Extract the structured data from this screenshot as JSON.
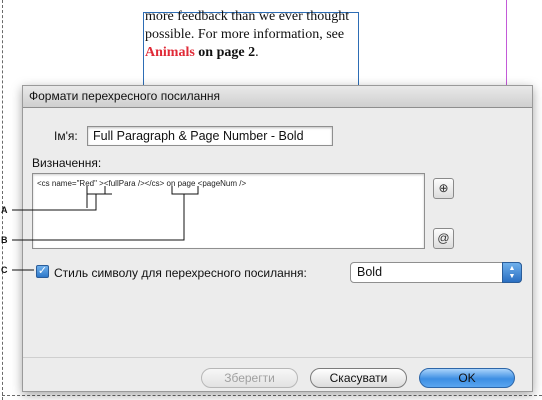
{
  "document": {
    "line1": "more feedback than we ever thought",
    "line2": "possible. For more information, see",
    "link_red": "Animals",
    "link_bold": " on page 2",
    "period": "."
  },
  "dialog": {
    "title": "Формати перехресного посилання",
    "name_label": "Ім'я:",
    "name_value": "Full Paragraph & Page Number - Bold",
    "definition_label": "Визначення:",
    "definition_code": "<cs name=\"Red\" ><fullPara /></cs> on page <pageNum />",
    "checkbox_label": "Стиль символу для перехресного посилання:",
    "checkbox_checked": true,
    "style_value": "Bold",
    "buttons": {
      "save": "Зберегти",
      "cancel": "Скасувати",
      "ok": "OK"
    }
  },
  "callouts": {
    "a": "A",
    "b": "B",
    "c": "C"
  },
  "icons": {
    "insert_building_block": "insert-building-block-icon",
    "insert_special_char": "insert-special-character-icon",
    "check": "checkmark-icon"
  },
  "colors": {
    "link_red": "#e02a37",
    "ok_button": "#3d8ee3",
    "frame_blue": "#2d6db5",
    "guide_magenta": "#c35ad8"
  }
}
